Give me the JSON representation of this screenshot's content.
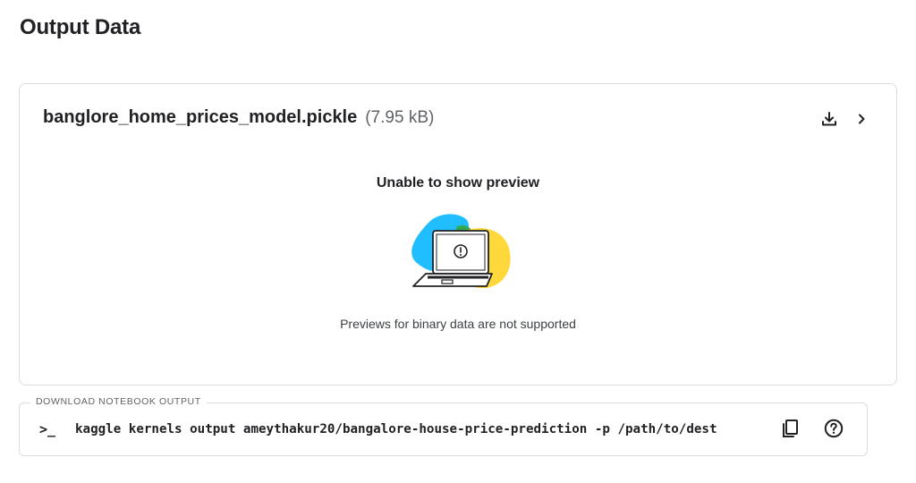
{
  "page": {
    "title": "Output Data"
  },
  "file": {
    "name": "banglore_home_prices_model.pickle",
    "size": "(7.95 kB)",
    "download_icon": "download-icon",
    "expand_icon": "chevron-right-icon"
  },
  "preview": {
    "title": "Unable to show preview",
    "message": "Previews for binary data are not supported",
    "illustration": "laptop-warning-illustration"
  },
  "cli": {
    "legend": "DOWNLOAD NOTEBOOK OUTPUT",
    "prompt": ">_",
    "command": "kaggle kernels output ameythakur20/bangalore-house-price-prediction -p /path/to/dest",
    "copy_icon": "copy-icon",
    "help_icon": "help-icon"
  },
  "colors": {
    "blue_blob": "#20BEFF",
    "green_blob": "#34A853",
    "yellow_blob": "#FFD93B",
    "border": "#dadce0",
    "text": "#202124"
  }
}
